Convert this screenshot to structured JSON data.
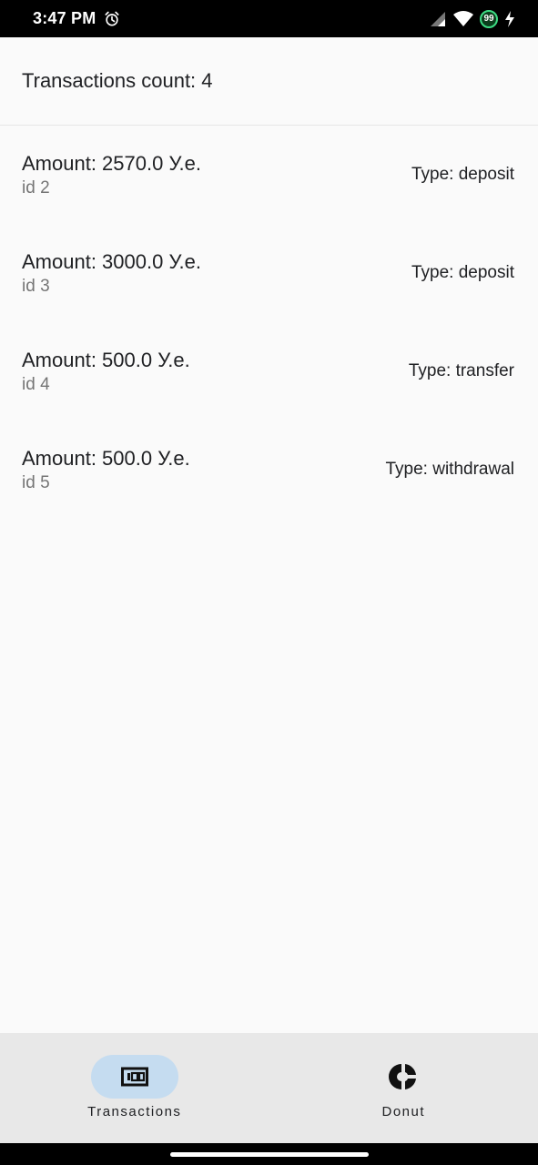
{
  "status_bar": {
    "time": "3:47 PM",
    "battery_level": "99",
    "icons": [
      "alarm-icon",
      "signal-icon",
      "wifi-icon",
      "battery-icon",
      "charging-icon"
    ]
  },
  "header": {
    "title": "Transactions count: 4"
  },
  "transactions": [
    {
      "amount": "Amount: 2570.0 У.е.",
      "id": "id 2",
      "type": "Type: deposit"
    },
    {
      "amount": "Amount: 3000.0 У.е.",
      "id": "id 3",
      "type": "Type: deposit"
    },
    {
      "amount": "Amount: 500.0 У.е.",
      "id": "id 4",
      "type": "Type: transfer"
    },
    {
      "amount": "Amount: 500.0 У.е.",
      "id": "id 5",
      "type": "Type: withdrawal"
    }
  ],
  "bottom_nav": {
    "items": [
      {
        "label": "Transactions",
        "icon": "money-icon",
        "active": true
      },
      {
        "label": "Donut",
        "icon": "donut-chart-icon",
        "active": false
      }
    ]
  },
  "colors": {
    "background": "#fafafa",
    "nav_background": "#e8e8e8",
    "active_pill": "#c5dcf0",
    "secondary_text": "#757575"
  }
}
